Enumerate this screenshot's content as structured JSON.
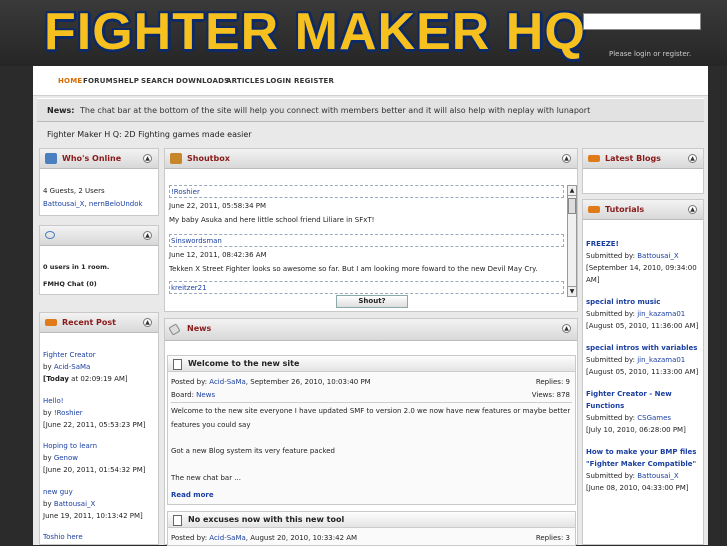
{
  "site": {
    "title": "FIGHTER MAKER HQ",
    "login_note": "Please login or register."
  },
  "nav": [
    "HOME",
    "FORUMS",
    "HELP",
    "SEARCH",
    "DOWNLOADS",
    "ARTICLES",
    "LOGIN",
    "REGISTER"
  ],
  "news": {
    "label": "News:",
    "text": "The chat bar at the bottom of the site will help you connect with members better and it will also help with neplay with lunaport"
  },
  "tagline": "Fighter Maker H Q: 2D Fighting games made easier",
  "whos_online": {
    "title": "Who's Online",
    "guests": "4 Guests, 2 Users",
    "users": "Battousai_X, nernBeloUndok"
  },
  "chat": {
    "rooms": "0 users in 1 room.",
    "room_name": "FMHQ Chat (0)"
  },
  "recent": {
    "title": "Recent Post",
    "items": [
      {
        "title": "Fighter Creator",
        "by": "by",
        "author": "Acid-SaMa",
        "date_bold": "[Today",
        "date": " at 02:09:19 AM]"
      },
      {
        "title": "Hello!",
        "by": "by",
        "author": "!Roshier",
        "date": "[June 22, 2011, 05:53:23 PM]"
      },
      {
        "title": "Hoping to learn",
        "by": "by",
        "author": "Genow",
        "date": "[June 20, 2011, 01:54:32 PM]"
      },
      {
        "title": "new guy",
        "by": "by",
        "author": "Battousai_X",
        "date": "June 19, 2011, 10:13:42 PM]"
      },
      {
        "title": "Toshio here"
      }
    ]
  },
  "shoutbox": {
    "title": "Shoutbox",
    "button": "Shout?",
    "shouts": [
      {
        "user": "!Roshier",
        "date": "June 22, 2011, 05:58:34 PM",
        "text": "My baby Asuka and here little school friend Liliare in SFxT!"
      },
      {
        "user": "Sinswordsman",
        "date": "June 12, 2011, 08:42:36 AM",
        "text": "Tekken X Street Fighter looks so awesome so far. But I am looking more foward to the new Devil May Cry."
      },
      {
        "user": "kreitzer21"
      }
    ]
  },
  "news_panel": {
    "title": "News",
    "read_more": "Read more",
    "posts": [
      {
        "title": "Welcome to the new site",
        "posted_by": "Posted by:",
        "author": "Acid-SaMa",
        "date": ", September 26, 2010, 10:03:40 PM",
        "replies": "Replies: 9",
        "board_label": "Board:",
        "board": "News",
        "views": "Views: 878",
        "body": [
          "Welcome to the new site everyone I have updated SMF to version 2.0 we now have new features or maybe better",
          "features you could say",
          "",
          "Got a new Blog system its very feature packed",
          "",
          "The new chat bar ..."
        ]
      },
      {
        "title": "No excuses now with this new tool",
        "posted_by": "Posted by:",
        "author": "Acid-SaMa",
        "date": ", August 20, 2010, 10:33:42 AM",
        "replies": "Replies: 3"
      }
    ]
  },
  "blogs": {
    "title": "Latest Blogs"
  },
  "tutorials": {
    "title": "Tutorials",
    "submitted": "Submitted by:",
    "items": [
      {
        "title": "FREEZE!",
        "author": "Battousai_X",
        "date": "[September 14, 2010, 09:34:00",
        "date2": "AM]"
      },
      {
        "title": "special intro music",
        "author": "jin_kazama01",
        "date": "[August 05, 2010, 11:36:00 AM]"
      },
      {
        "title": "special intros with variables",
        "author": "jin_kazama01",
        "date": "[August 05, 2010, 11:33:00 AM]"
      },
      {
        "title": "Fighter Creator - New",
        "title2": "Functions",
        "author": "CSGames",
        "date": "[July 10, 2010, 06:28:00 PM]"
      },
      {
        "title": "How to make your BMP files",
        "title2": "\"Fighter Maker Compatible\"",
        "author": "Battousai_X",
        "date": "[June 08, 2010, 04:33:00 PM]"
      }
    ]
  }
}
